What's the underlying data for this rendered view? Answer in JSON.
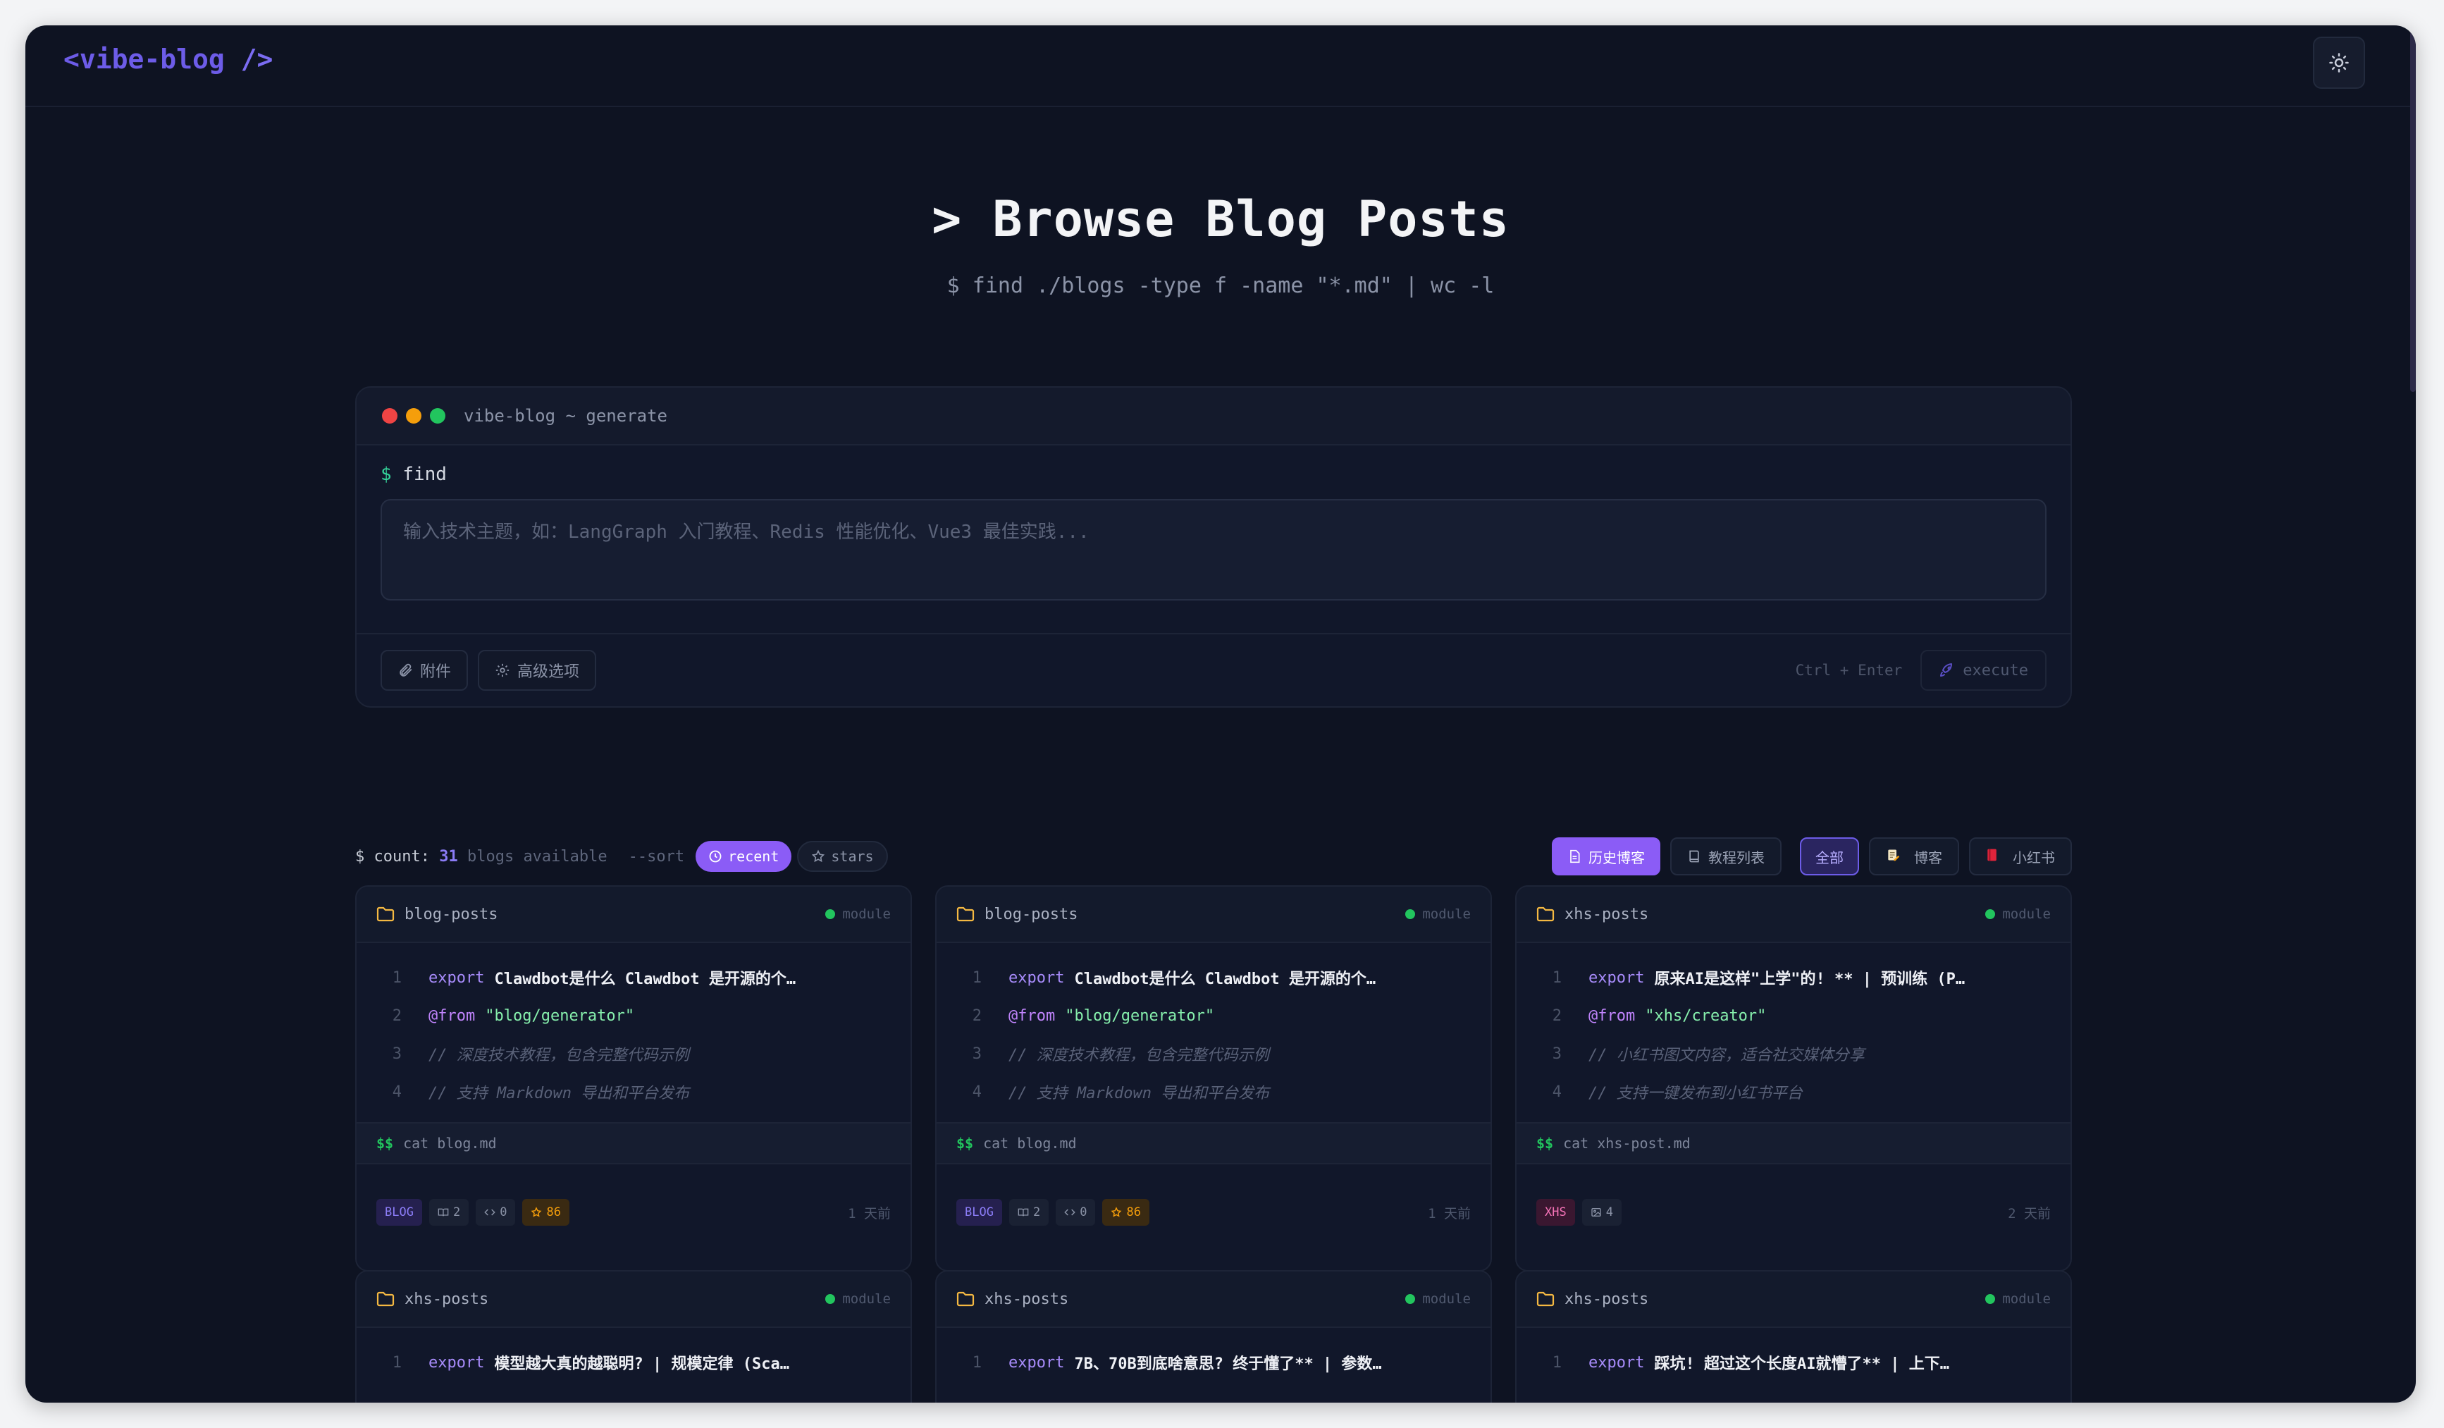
{
  "header": {
    "logo_open": "<vibe-blog",
    "logo_close": " />",
    "theme_icon": "sun-icon"
  },
  "hero": {
    "title": "> Browse Blog Posts",
    "subtitle": "$ find ./blogs -type f -name \"*.md\" | wc -l"
  },
  "terminal": {
    "title": "vibe-blog ~ generate",
    "prompt_symbol": "$",
    "prompt_cmd": "find",
    "input_placeholder": "输入技术主题，如：LangGraph 入门教程、Redis 性能优化、Vue3 最佳实践...",
    "attach_label": "附件",
    "advanced_label": "高级选项",
    "shortcut": "Ctrl + Enter",
    "execute_label": "execute",
    "dot_colors": [
      "#ef4444",
      "#f59e0b",
      "#22c55e"
    ]
  },
  "toolbar": {
    "count_prefix": "$ count:",
    "count_value": "31",
    "count_suffix": "blogs available",
    "sort_label": "--sort",
    "sort_recent": "recent",
    "sort_stars": "stars",
    "tab_history": "历史博客",
    "tab_tutorials": "教程列表",
    "filter_all": "全部",
    "filter_blog": "博客",
    "filter_xhs": "小红书"
  },
  "cards": [
    {
      "path": "blog-posts",
      "module": "module",
      "kw": "export",
      "title": "Clawdbot是什么 Clawdbot 是开源的个…",
      "from_kw": "@from",
      "from": "\"blog/generator\"",
      "comment1": "// 深度技术教程，包含完整代码示例",
      "comment2": "// 支持 Markdown 导出和平台发布",
      "cat_prefix": "$$",
      "cat": "cat blog.md",
      "badge": "BLOG",
      "stat1": "2",
      "stat2": "0",
      "stars": "86",
      "time": "1 天前"
    },
    {
      "path": "blog-posts",
      "module": "module",
      "kw": "export",
      "title": "Clawdbot是什么 Clawdbot 是开源的个…",
      "from_kw": "@from",
      "from": "\"blog/generator\"",
      "comment1": "// 深度技术教程，包含完整代码示例",
      "comment2": "// 支持 Markdown 导出和平台发布",
      "cat_prefix": "$$",
      "cat": "cat blog.md",
      "badge": "BLOG",
      "stat1": "2",
      "stat2": "0",
      "stars": "86",
      "time": "1 天前"
    },
    {
      "path": "xhs-posts",
      "module": "module",
      "kw": "export",
      "title": "原来AI是这样\"上学\"的! ** | 预训练 (P…",
      "from_kw": "@from",
      "from": "\"xhs/creator\"",
      "comment1": "// 小红书图文内容，适合社交媒体分享",
      "comment2": "// 支持一键发布到小红书平台",
      "cat_prefix": "$$",
      "cat": "cat xhs-post.md",
      "badge": "XHS",
      "stat1": "4",
      "time": "2 天前"
    },
    {
      "path": "xhs-posts",
      "module": "module",
      "kw": "export",
      "title": "模型越大真的越聪明? | 规模定律 (Sca…"
    },
    {
      "path": "xhs-posts",
      "module": "module",
      "kw": "export",
      "title": "7B、70B到底啥意思? 终于懂了** | 参数…"
    },
    {
      "path": "xhs-posts",
      "module": "module",
      "kw": "export",
      "title": "踩坑! 超过这个长度AI就懵了** | 上下…"
    }
  ],
  "colors": {
    "accent": "#8b5cf6",
    "background": "#0e1322",
    "folder": "#f5b942",
    "module_dot": "#22c55e"
  }
}
